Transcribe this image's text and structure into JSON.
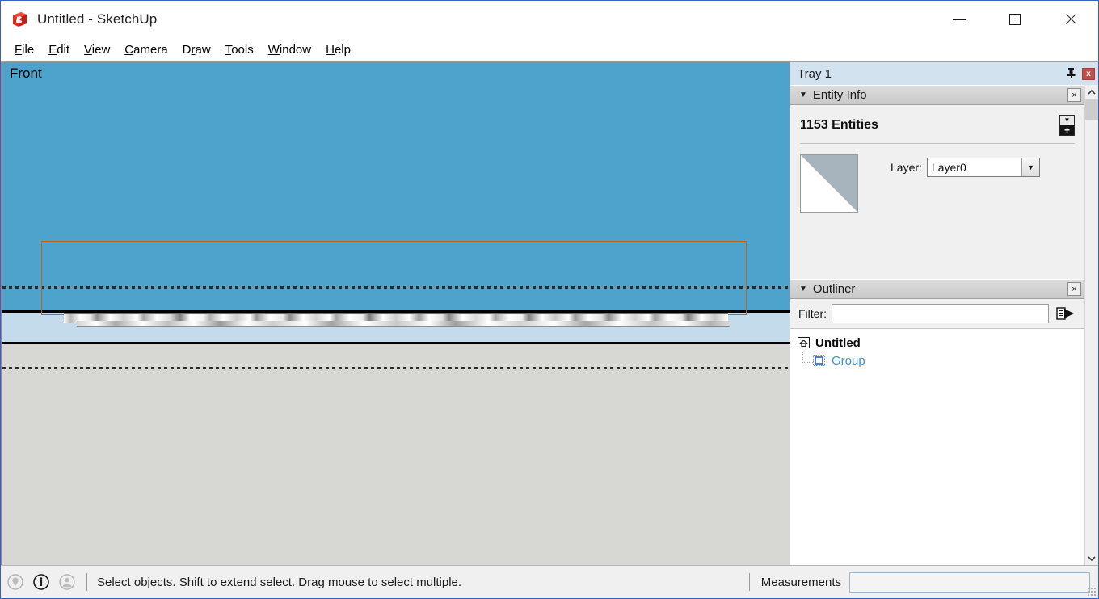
{
  "window": {
    "title": "Untitled - SketchUp",
    "app_icon": "sketchup-logo-icon",
    "controls": {
      "minimize": "minimize-icon",
      "maximize": "maximize-icon",
      "close": "close-icon"
    }
  },
  "menubar": {
    "items": [
      {
        "label": "File",
        "accel": "F"
      },
      {
        "label": "Edit",
        "accel": "E"
      },
      {
        "label": "View",
        "accel": "V"
      },
      {
        "label": "Camera",
        "accel": "C"
      },
      {
        "label": "Draw",
        "accel": "r"
      },
      {
        "label": "Tools",
        "accel": "T"
      },
      {
        "label": "Window",
        "accel": "W"
      },
      {
        "label": "Help",
        "accel": "H"
      }
    ]
  },
  "viewport": {
    "view_label": "Front",
    "sky_color": "#4da3cc",
    "water_color": "#c3dbea",
    "ground_color": "#d7d7d3",
    "selection_color": "#b5651d",
    "axis_color": "#2a2a2a"
  },
  "tray": {
    "title": "Tray 1",
    "pin_icon": "pushpin-icon",
    "close_icon": "close-icon",
    "close_label": "x",
    "entity_info": {
      "caret": "▼",
      "title": "Entity Info",
      "close_label": "×",
      "count_label": "1153 Entities",
      "expand_top": "▼",
      "expand_bottom": "+",
      "layer_label": "Layer:",
      "layer_value": "Layer0",
      "layer_options": [
        "Layer0"
      ],
      "combo_arrow": "▼"
    },
    "outliner": {
      "caret": "▼",
      "title": "Outliner",
      "close_label": "×",
      "filter_label": "Filter:",
      "filter_value": "",
      "filter_placeholder": "",
      "details_icon": "details-arrow-icon",
      "tree": [
        {
          "label": "Untitled",
          "icon": "home-icon",
          "level": 0,
          "selected": false
        },
        {
          "label": "Group",
          "icon": "group-icon",
          "level": 1,
          "selected": true
        }
      ]
    },
    "scrollbar": {
      "up_arrow": "︿",
      "down_arrow": "﹀"
    }
  },
  "statusbar": {
    "icons": [
      {
        "name": "geo-location-icon",
        "state": "disabled"
      },
      {
        "name": "info-icon",
        "state": "active"
      },
      {
        "name": "account-icon",
        "state": "disabled"
      }
    ],
    "hint": "Select objects. Shift to extend select. Drag mouse to select multiple.",
    "measurements_label": "Measurements",
    "measurements_value": "",
    "measurements_placeholder": ""
  }
}
